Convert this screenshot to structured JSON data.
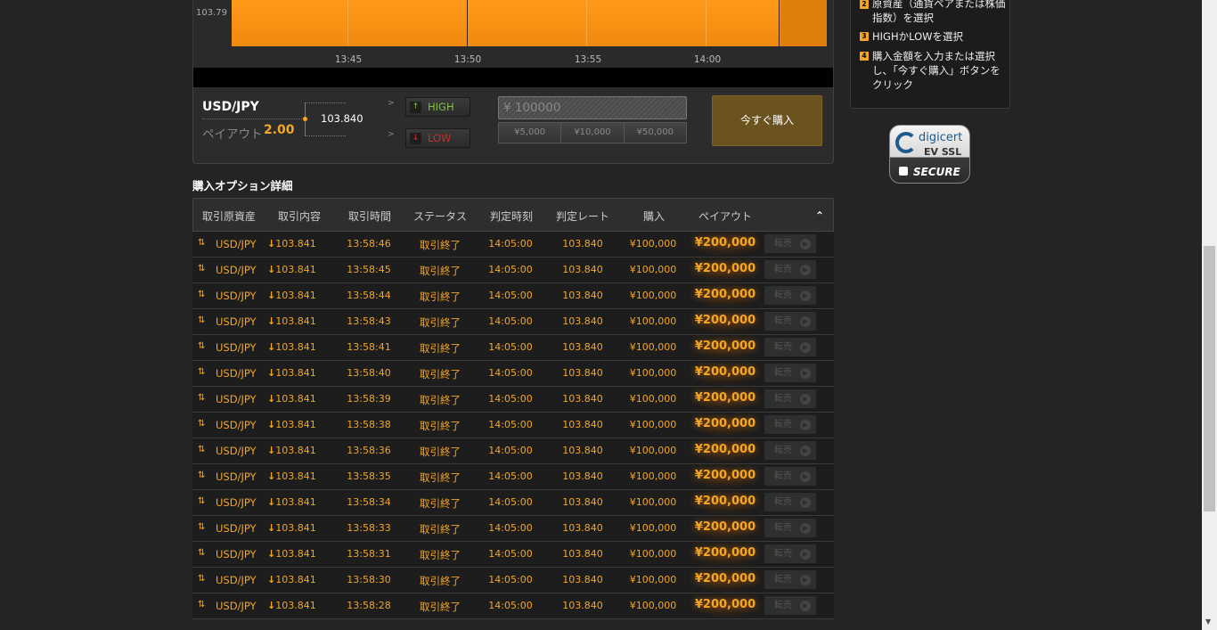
{
  "chart": {
    "y_label": "103.79",
    "x_ticks": [
      "13:45",
      "13:50",
      "13:55",
      "14:00"
    ]
  },
  "trade": {
    "asset": "USD/JPY",
    "payout_label": "ペイアウト",
    "payout_value": "2.00",
    "rate": "103.840",
    "chevron": ">",
    "high_label": "HIGH",
    "low_label": "LOW",
    "amount_placeholder": "¥ 100000",
    "presets": [
      "¥5,000",
      "¥10,000",
      "¥50,000"
    ],
    "buy_label": "今すぐ購入"
  },
  "details": {
    "title": "購入オプション詳細",
    "headers": [
      "取引原資産",
      "取引内容",
      "取引時間",
      "ステータス",
      "判定時刻",
      "判定レート",
      "購入",
      "ペイアウト"
    ],
    "resell_label": "転売",
    "rows": [
      {
        "asset": "USD/JPY",
        "direction": "103.841",
        "time": "13:58:46",
        "status": "取引終了",
        "judge_time": "14:05:00",
        "judge_rate": "103.840",
        "purchase": "¥100,000",
        "payout": "¥200,000"
      },
      {
        "asset": "USD/JPY",
        "direction": "103.841",
        "time": "13:58:45",
        "status": "取引終了",
        "judge_time": "14:05:00",
        "judge_rate": "103.840",
        "purchase": "¥100,000",
        "payout": "¥200,000"
      },
      {
        "asset": "USD/JPY",
        "direction": "103.841",
        "time": "13:58:44",
        "status": "取引終了",
        "judge_time": "14:05:00",
        "judge_rate": "103.840",
        "purchase": "¥100,000",
        "payout": "¥200,000"
      },
      {
        "asset": "USD/JPY",
        "direction": "103.841",
        "time": "13:58:43",
        "status": "取引終了",
        "judge_time": "14:05:00",
        "judge_rate": "103.840",
        "purchase": "¥100,000",
        "payout": "¥200,000"
      },
      {
        "asset": "USD/JPY",
        "direction": "103.841",
        "time": "13:58:41",
        "status": "取引終了",
        "judge_time": "14:05:00",
        "judge_rate": "103.840",
        "purchase": "¥100,000",
        "payout": "¥200,000"
      },
      {
        "asset": "USD/JPY",
        "direction": "103.841",
        "time": "13:58:40",
        "status": "取引終了",
        "judge_time": "14:05:00",
        "judge_rate": "103.840",
        "purchase": "¥100,000",
        "payout": "¥200,000"
      },
      {
        "asset": "USD/JPY",
        "direction": "103.841",
        "time": "13:58:39",
        "status": "取引終了",
        "judge_time": "14:05:00",
        "judge_rate": "103.840",
        "purchase": "¥100,000",
        "payout": "¥200,000"
      },
      {
        "asset": "USD/JPY",
        "direction": "103.841",
        "time": "13:58:38",
        "status": "取引終了",
        "judge_time": "14:05:00",
        "judge_rate": "103.840",
        "purchase": "¥100,000",
        "payout": "¥200,000"
      },
      {
        "asset": "USD/JPY",
        "direction": "103.841",
        "time": "13:58:36",
        "status": "取引終了",
        "judge_time": "14:05:00",
        "judge_rate": "103.840",
        "purchase": "¥100,000",
        "payout": "¥200,000"
      },
      {
        "asset": "USD/JPY",
        "direction": "103.841",
        "time": "13:58:35",
        "status": "取引終了",
        "judge_time": "14:05:00",
        "judge_rate": "103.840",
        "purchase": "¥100,000",
        "payout": "¥200,000"
      },
      {
        "asset": "USD/JPY",
        "direction": "103.841",
        "time": "13:58:34",
        "status": "取引終了",
        "judge_time": "14:05:00",
        "judge_rate": "103.840",
        "purchase": "¥100,000",
        "payout": "¥200,000"
      },
      {
        "asset": "USD/JPY",
        "direction": "103.841",
        "time": "13:58:33",
        "status": "取引終了",
        "judge_time": "14:05:00",
        "judge_rate": "103.840",
        "purchase": "¥100,000",
        "payout": "¥200,000"
      },
      {
        "asset": "USD/JPY",
        "direction": "103.841",
        "time": "13:58:31",
        "status": "取引終了",
        "judge_time": "14:05:00",
        "judge_rate": "103.840",
        "purchase": "¥100,000",
        "payout": "¥200,000"
      },
      {
        "asset": "USD/JPY",
        "direction": "103.841",
        "time": "13:58:30",
        "status": "取引終了",
        "judge_time": "14:05:00",
        "judge_rate": "103.840",
        "purchase": "¥100,000",
        "payout": "¥200,000"
      },
      {
        "asset": "USD/JPY",
        "direction": "103.841",
        "time": "13:58:28",
        "status": "取引終了",
        "judge_time": "14:05:00",
        "judge_rate": "103.840",
        "purchase": "¥100,000",
        "payout": "¥200,000"
      }
    ]
  },
  "steps": [
    {
      "num": "2",
      "text": "原資産（通貨ペアまたは株価指数）を選択"
    },
    {
      "num": "3",
      "text": "HIGHかLOWを選択"
    },
    {
      "num": "4",
      "text": "購入金額を入力または選択し、「今すぐ購入」ボタンをクリック"
    }
  ],
  "ssl": {
    "brand": "digicert",
    "ev": "EV SSL",
    "secure": "SECURE"
  },
  "colors": {
    "accent": "#f5a623",
    "chart_fill": "#ff9a1a",
    "high": "#7fc341",
    "low": "#c8302a",
    "background": "#242424"
  },
  "icons": {
    "row_swap": "swap-arrows-icon",
    "direction_down": "arrow-down-icon",
    "collapse": "double-chevron-up-icon",
    "resell": "play-circle-icon"
  }
}
